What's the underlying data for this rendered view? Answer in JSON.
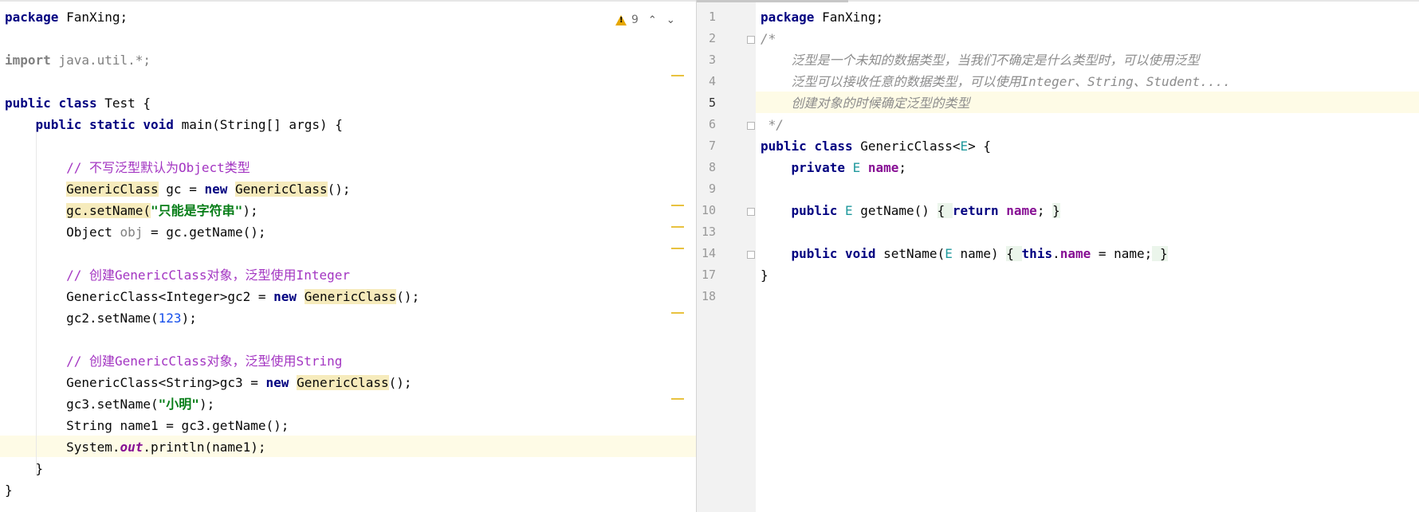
{
  "editor_left": {
    "inspection_count": "9",
    "lines": [
      {
        "segs": [
          {
            "t": "package",
            "c": "kw"
          },
          {
            "t": " FanXing;"
          }
        ]
      },
      {
        "segs": []
      },
      {
        "segs": [
          {
            "t": "import",
            "c": "kw gray"
          },
          {
            "t": " java.util.*;",
            "c": "gray"
          }
        ]
      },
      {
        "segs": []
      },
      {
        "segs": [
          {
            "t": "public",
            "c": "kw"
          },
          {
            "t": " "
          },
          {
            "t": "class",
            "c": "kw"
          },
          {
            "t": " Test {"
          }
        ]
      },
      {
        "segs": [
          {
            "t": "    "
          },
          {
            "t": "public",
            "c": "kw"
          },
          {
            "t": " "
          },
          {
            "t": "static",
            "c": "kw"
          },
          {
            "t": " "
          },
          {
            "t": "void",
            "c": "kw"
          },
          {
            "t": " main(String[] args) {"
          }
        ]
      },
      {
        "segs": []
      },
      {
        "segs": [
          {
            "t": "        "
          },
          {
            "t": "// 不写泛型默认为Object类型",
            "c": "cmt"
          }
        ]
      },
      {
        "segs": [
          {
            "t": "        "
          },
          {
            "t": "GenericClass",
            "c": "mark"
          },
          {
            "t": " gc = "
          },
          {
            "t": "new",
            "c": "kw"
          },
          {
            "t": " "
          },
          {
            "t": "GenericClass",
            "c": "mark"
          },
          {
            "t": "();"
          }
        ]
      },
      {
        "segs": [
          {
            "t": "        "
          },
          {
            "t": "gc.setName(",
            "c": "mark"
          },
          {
            "t": "\"只能是字符串\"",
            "c": "str"
          },
          {
            "t": ");"
          }
        ]
      },
      {
        "segs": [
          {
            "t": "        Object "
          },
          {
            "t": "obj",
            "c": "gray"
          },
          {
            "t": " = gc.getName();"
          }
        ]
      },
      {
        "segs": []
      },
      {
        "segs": [
          {
            "t": "        "
          },
          {
            "t": "// 创建GenericClass对象，泛型使用Integer",
            "c": "cmt"
          }
        ]
      },
      {
        "segs": [
          {
            "t": "        GenericClass<Integer>gc2 = "
          },
          {
            "t": "new",
            "c": "kw"
          },
          {
            "t": " "
          },
          {
            "t": "GenericClass",
            "c": "mark"
          },
          {
            "t": "();"
          }
        ]
      },
      {
        "segs": [
          {
            "t": "        gc2.setName("
          },
          {
            "t": "123",
            "c": "num"
          },
          {
            "t": ");"
          }
        ]
      },
      {
        "segs": []
      },
      {
        "segs": [
          {
            "t": "        "
          },
          {
            "t": "// 创建GenericClass对象，泛型使用String",
            "c": "cmt"
          }
        ]
      },
      {
        "segs": [
          {
            "t": "        GenericClass<String>gc3 = "
          },
          {
            "t": "new",
            "c": "kw"
          },
          {
            "t": " "
          },
          {
            "t": "GenericClass",
            "c": "mark"
          },
          {
            "t": "();"
          }
        ]
      },
      {
        "segs": [
          {
            "t": "        gc3.setName("
          },
          {
            "t": "\"小明\"",
            "c": "str"
          },
          {
            "t": ");"
          }
        ]
      },
      {
        "segs": [
          {
            "t": "        String name1 = gc3.getName();"
          }
        ]
      },
      {
        "segs": [
          {
            "t": "        System."
          },
          {
            "t": "out",
            "c": "static"
          },
          {
            "t": ".println(name1);"
          }
        ]
      },
      {
        "segs": [
          {
            "t": "    }"
          }
        ]
      },
      {
        "segs": [
          {
            "t": "}"
          }
        ]
      }
    ]
  },
  "editor_right": {
    "lines": [
      {
        "num": "1",
        "segs": [
          {
            "t": "package",
            "c": "kw"
          },
          {
            "t": " FanXing;"
          }
        ]
      },
      {
        "num": "2",
        "segs": [
          {
            "t": "/*",
            "c": "doc"
          }
        ]
      },
      {
        "num": "3",
        "segs": [
          {
            "t": "    "
          },
          {
            "t": "泛型是一个未知的数据类型，当我们不确定是什么类型时，可以使用泛型",
            "c": "doc"
          }
        ]
      },
      {
        "num": "4",
        "segs": [
          {
            "t": "    "
          },
          {
            "t": "泛型可以接收任意的数据类型，可以使用Integer、String、Student....",
            "c": "doc"
          }
        ]
      },
      {
        "num": "5",
        "segs": [
          {
            "t": "    "
          },
          {
            "t": "创建对象的时候确定泛型的类型",
            "c": "doc"
          }
        ]
      },
      {
        "num": "6",
        "segs": [
          {
            "t": " */",
            "c": "doc"
          }
        ]
      },
      {
        "num": "7",
        "segs": [
          {
            "t": "public",
            "c": "kw"
          },
          {
            "t": " "
          },
          {
            "t": "class",
            "c": "kw"
          },
          {
            "t": " GenericClass<"
          },
          {
            "t": "E",
            "c": "tparam"
          },
          {
            "t": "> {"
          }
        ]
      },
      {
        "num": "8",
        "segs": [
          {
            "t": "    "
          },
          {
            "t": "private",
            "c": "kw"
          },
          {
            "t": " "
          },
          {
            "t": "E",
            "c": "tparam"
          },
          {
            "t": " "
          },
          {
            "t": "name",
            "c": "field"
          },
          {
            "t": ";"
          }
        ]
      },
      {
        "num": "9",
        "segs": []
      },
      {
        "num": "10",
        "segs": [
          {
            "t": "    "
          },
          {
            "t": "public",
            "c": "kw"
          },
          {
            "t": " "
          },
          {
            "t": "E",
            "c": "tparam"
          },
          {
            "t": " getName() "
          },
          {
            "t": "{ ",
            "c": "fold"
          },
          {
            "t": "return",
            "c": "kw"
          },
          {
            "t": " "
          },
          {
            "t": "name",
            "c": "field"
          },
          {
            "t": "; "
          },
          {
            "t": "}",
            "c": "fold"
          }
        ]
      },
      {
        "num": "13",
        "segs": []
      },
      {
        "num": "14",
        "segs": [
          {
            "t": "    "
          },
          {
            "t": "public",
            "c": "kw"
          },
          {
            "t": " "
          },
          {
            "t": "void",
            "c": "kw"
          },
          {
            "t": " setName("
          },
          {
            "t": "E",
            "c": "tparam"
          },
          {
            "t": " name) "
          },
          {
            "t": "{ ",
            "c": "fold"
          },
          {
            "t": "this",
            "c": "kw"
          },
          {
            "t": "."
          },
          {
            "t": "name",
            "c": "field"
          },
          {
            "t": " = name;"
          },
          {
            "t": " }",
            "c": "fold"
          }
        ]
      },
      {
        "num": "17",
        "segs": [
          {
            "t": "}"
          }
        ]
      },
      {
        "num": "18",
        "segs": []
      }
    ]
  }
}
